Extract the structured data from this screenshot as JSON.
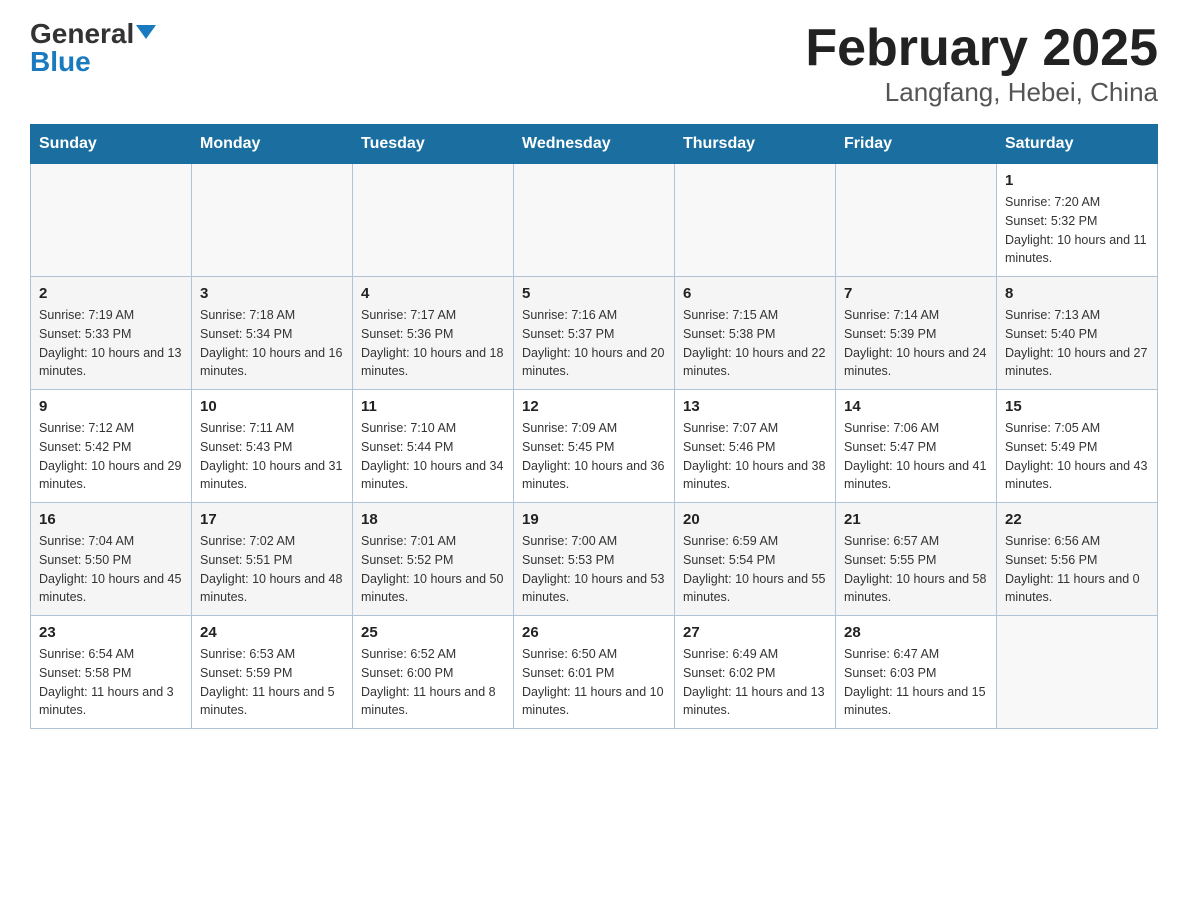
{
  "logo": {
    "general": "General",
    "blue": "Blue"
  },
  "title": "February 2025",
  "subtitle": "Langfang, Hebei, China",
  "days_of_week": [
    "Sunday",
    "Monday",
    "Tuesday",
    "Wednesday",
    "Thursday",
    "Friday",
    "Saturday"
  ],
  "weeks": [
    [
      null,
      null,
      null,
      null,
      null,
      null,
      {
        "day": "1",
        "sunrise": "Sunrise: 7:20 AM",
        "sunset": "Sunset: 5:32 PM",
        "daylight": "Daylight: 10 hours and 11 minutes."
      }
    ],
    [
      {
        "day": "2",
        "sunrise": "Sunrise: 7:19 AM",
        "sunset": "Sunset: 5:33 PM",
        "daylight": "Daylight: 10 hours and 13 minutes."
      },
      {
        "day": "3",
        "sunrise": "Sunrise: 7:18 AM",
        "sunset": "Sunset: 5:34 PM",
        "daylight": "Daylight: 10 hours and 16 minutes."
      },
      {
        "day": "4",
        "sunrise": "Sunrise: 7:17 AM",
        "sunset": "Sunset: 5:36 PM",
        "daylight": "Daylight: 10 hours and 18 minutes."
      },
      {
        "day": "5",
        "sunrise": "Sunrise: 7:16 AM",
        "sunset": "Sunset: 5:37 PM",
        "daylight": "Daylight: 10 hours and 20 minutes."
      },
      {
        "day": "6",
        "sunrise": "Sunrise: 7:15 AM",
        "sunset": "Sunset: 5:38 PM",
        "daylight": "Daylight: 10 hours and 22 minutes."
      },
      {
        "day": "7",
        "sunrise": "Sunrise: 7:14 AM",
        "sunset": "Sunset: 5:39 PM",
        "daylight": "Daylight: 10 hours and 24 minutes."
      },
      {
        "day": "8",
        "sunrise": "Sunrise: 7:13 AM",
        "sunset": "Sunset: 5:40 PM",
        "daylight": "Daylight: 10 hours and 27 minutes."
      }
    ],
    [
      {
        "day": "9",
        "sunrise": "Sunrise: 7:12 AM",
        "sunset": "Sunset: 5:42 PM",
        "daylight": "Daylight: 10 hours and 29 minutes."
      },
      {
        "day": "10",
        "sunrise": "Sunrise: 7:11 AM",
        "sunset": "Sunset: 5:43 PM",
        "daylight": "Daylight: 10 hours and 31 minutes."
      },
      {
        "day": "11",
        "sunrise": "Sunrise: 7:10 AM",
        "sunset": "Sunset: 5:44 PM",
        "daylight": "Daylight: 10 hours and 34 minutes."
      },
      {
        "day": "12",
        "sunrise": "Sunrise: 7:09 AM",
        "sunset": "Sunset: 5:45 PM",
        "daylight": "Daylight: 10 hours and 36 minutes."
      },
      {
        "day": "13",
        "sunrise": "Sunrise: 7:07 AM",
        "sunset": "Sunset: 5:46 PM",
        "daylight": "Daylight: 10 hours and 38 minutes."
      },
      {
        "day": "14",
        "sunrise": "Sunrise: 7:06 AM",
        "sunset": "Sunset: 5:47 PM",
        "daylight": "Daylight: 10 hours and 41 minutes."
      },
      {
        "day": "15",
        "sunrise": "Sunrise: 7:05 AM",
        "sunset": "Sunset: 5:49 PM",
        "daylight": "Daylight: 10 hours and 43 minutes."
      }
    ],
    [
      {
        "day": "16",
        "sunrise": "Sunrise: 7:04 AM",
        "sunset": "Sunset: 5:50 PM",
        "daylight": "Daylight: 10 hours and 45 minutes."
      },
      {
        "day": "17",
        "sunrise": "Sunrise: 7:02 AM",
        "sunset": "Sunset: 5:51 PM",
        "daylight": "Daylight: 10 hours and 48 minutes."
      },
      {
        "day": "18",
        "sunrise": "Sunrise: 7:01 AM",
        "sunset": "Sunset: 5:52 PM",
        "daylight": "Daylight: 10 hours and 50 minutes."
      },
      {
        "day": "19",
        "sunrise": "Sunrise: 7:00 AM",
        "sunset": "Sunset: 5:53 PM",
        "daylight": "Daylight: 10 hours and 53 minutes."
      },
      {
        "day": "20",
        "sunrise": "Sunrise: 6:59 AM",
        "sunset": "Sunset: 5:54 PM",
        "daylight": "Daylight: 10 hours and 55 minutes."
      },
      {
        "day": "21",
        "sunrise": "Sunrise: 6:57 AM",
        "sunset": "Sunset: 5:55 PM",
        "daylight": "Daylight: 10 hours and 58 minutes."
      },
      {
        "day": "22",
        "sunrise": "Sunrise: 6:56 AM",
        "sunset": "Sunset: 5:56 PM",
        "daylight": "Daylight: 11 hours and 0 minutes."
      }
    ],
    [
      {
        "day": "23",
        "sunrise": "Sunrise: 6:54 AM",
        "sunset": "Sunset: 5:58 PM",
        "daylight": "Daylight: 11 hours and 3 minutes."
      },
      {
        "day": "24",
        "sunrise": "Sunrise: 6:53 AM",
        "sunset": "Sunset: 5:59 PM",
        "daylight": "Daylight: 11 hours and 5 minutes."
      },
      {
        "day": "25",
        "sunrise": "Sunrise: 6:52 AM",
        "sunset": "Sunset: 6:00 PM",
        "daylight": "Daylight: 11 hours and 8 minutes."
      },
      {
        "day": "26",
        "sunrise": "Sunrise: 6:50 AM",
        "sunset": "Sunset: 6:01 PM",
        "daylight": "Daylight: 11 hours and 10 minutes."
      },
      {
        "day": "27",
        "sunrise": "Sunrise: 6:49 AM",
        "sunset": "Sunset: 6:02 PM",
        "daylight": "Daylight: 11 hours and 13 minutes."
      },
      {
        "day": "28",
        "sunrise": "Sunrise: 6:47 AM",
        "sunset": "Sunset: 6:03 PM",
        "daylight": "Daylight: 11 hours and 15 minutes."
      },
      null
    ]
  ]
}
